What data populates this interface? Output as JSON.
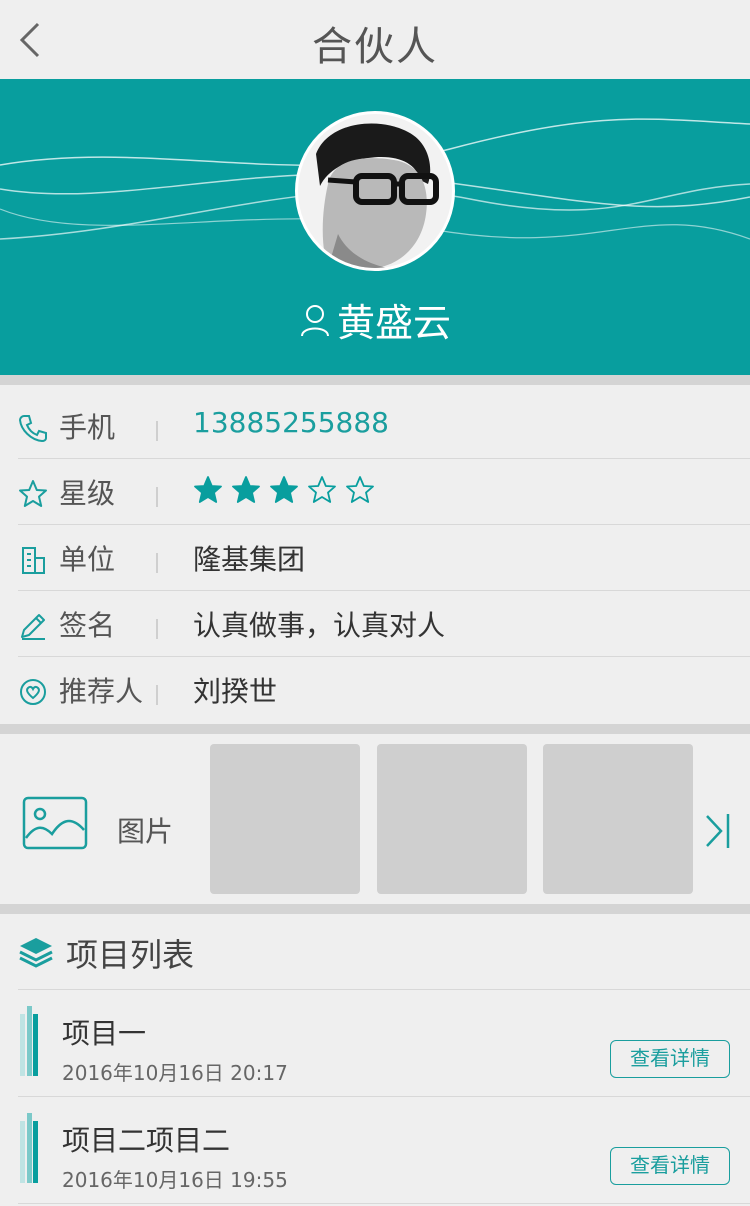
{
  "header": {
    "title": "合伙人"
  },
  "profile": {
    "name": "黄盛云"
  },
  "info": {
    "phone": {
      "label": "手机",
      "value": "13885255888"
    },
    "rating": {
      "label": "星级",
      "stars_filled": 3,
      "stars_total": 5
    },
    "company": {
      "label": "单位",
      "value": "隆基集团"
    },
    "signature": {
      "label": "签名",
      "value": "认真做事，认真对人"
    },
    "referrer": {
      "label": "推荐人",
      "value": "刘揆世"
    }
  },
  "pictures": {
    "label": "图片"
  },
  "projects": {
    "title": "项目列表",
    "items": [
      {
        "name": "项目一",
        "date": "2016年10月16日 20:17",
        "button": "查看详情"
      },
      {
        "name": "项目二项目二",
        "date": "2016年10月16日 19:55",
        "button": "查看详情"
      }
    ]
  },
  "colors": {
    "accent": "#089e9e",
    "background": "#efefef",
    "thumb": "#cfcfcf"
  }
}
